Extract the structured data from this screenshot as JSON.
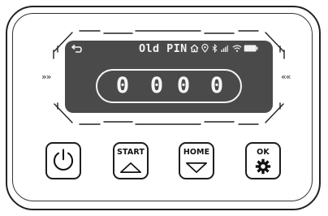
{
  "display": {
    "mode_label": "Old PIN",
    "pin_digits": [
      "0",
      "0",
      "0",
      "0"
    ]
  },
  "status_icons": [
    "back-arrow-icon",
    "home-icon",
    "location-icon",
    "bluetooth-icon",
    "signal-icon",
    "wifi-icon",
    "battery-icon"
  ],
  "side_indicators": {
    "left": "»»",
    "right": "««"
  },
  "buttons": {
    "power": {
      "icon": "power-icon"
    },
    "start": {
      "label": "START",
      "icon": "triangle-up-icon"
    },
    "home": {
      "label": "HOME",
      "icon": "triangle-down-icon"
    },
    "ok": {
      "label": "OK",
      "icon": "gear-icon"
    }
  }
}
